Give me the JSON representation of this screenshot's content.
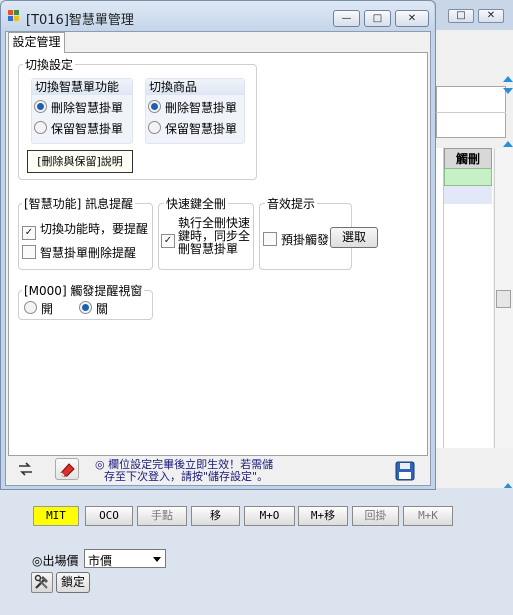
{
  "window": {
    "title": "[T016]智慧單管理",
    "minimize_glyph": "—",
    "maximize_glyph": "□",
    "close_glyph": "✕"
  },
  "tabs": [
    {
      "label": "設定管理"
    }
  ],
  "switch_settings": {
    "title": "切換設定",
    "smart_order": {
      "title": "切換智慧單功能",
      "options": [
        "刪除智慧掛單",
        "保留智慧掛單"
      ],
      "selected": 0
    },
    "product": {
      "title": "切換商品",
      "options": [
        "刪除智慧掛單",
        "保留智慧掛單"
      ],
      "selected": 0
    },
    "explain_button": "[刪除與保留]說明"
  },
  "reminder": {
    "title": "[智慧功能] 訊息提醒",
    "items": [
      {
        "label": "切換功能時，要提醒",
        "checked": true
      },
      {
        "label": "智慧掛單刪除提醒",
        "checked": false
      }
    ]
  },
  "hotkey": {
    "title": "快速鍵全刪",
    "label": "執行全刪快速鍵時，同步全刪智慧掛單",
    "line1": "執行全刪快速",
    "line2": "鍵時，同步全",
    "line3": "刪智慧掛單",
    "checked": true
  },
  "sound": {
    "title": "音效提示",
    "label": "預掛觸發",
    "checked": false,
    "select_button": "選取"
  },
  "popup": {
    "title": "[M000] 觸發提醒視窗",
    "options": [
      "開",
      "關"
    ],
    "selected": 1
  },
  "footer": {
    "notice_line1": "◎ 欄位設定完畢後立即生效！若需儲",
    "notice_line2": "存至下次登入，請按\"儲存設定\"。"
  },
  "background_window": {
    "grid_header": "觸刪",
    "order_buttons": [
      "MIT",
      "OCO",
      "手點",
      "移",
      "M+O",
      "M+移",
      "回掛",
      "M+K"
    ],
    "exit_price_label": "◎出場價",
    "exit_price_value": "市價",
    "lock_button": "鎖定"
  },
  "colors": {
    "accent_blue": "#1b5fb5",
    "mit_yellow": "#ffff00",
    "grid_green": "#c6f0c6",
    "eraser_red": "#d9302c"
  },
  "icons": [
    "transfer-icon",
    "eraser-icon",
    "save-icon",
    "wrench-hammer-icon",
    "dropdown-arrow-icon",
    "scroll-up-arrow-icon",
    "scroll-down-arrow-icon"
  ]
}
